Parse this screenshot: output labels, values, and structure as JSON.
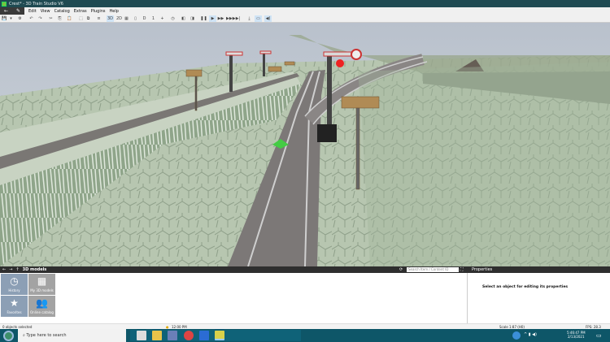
{
  "window": {
    "title": "Crest* - 3D Train Studio V6"
  },
  "menu": {
    "back": "←",
    "edit_mode": "✎",
    "items": [
      "Edit",
      "View",
      "Catalog",
      "Extras",
      "Plugins",
      "Help"
    ]
  },
  "toolbar": {
    "buttons": [
      {
        "name": "save",
        "glyph": "💾",
        "on": false
      },
      {
        "name": "save-dropdown",
        "glyph": "▾",
        "on": false
      },
      {
        "name": "settings",
        "glyph": "⚙",
        "on": false
      },
      {
        "name": "undo",
        "glyph": "↶",
        "on": false
      },
      {
        "name": "redo",
        "glyph": "↷",
        "on": false
      },
      {
        "name": "cut",
        "glyph": "✂",
        "on": false
      },
      {
        "name": "copy",
        "glyph": "⎘",
        "on": false
      },
      {
        "name": "paste",
        "glyph": "📋",
        "on": false
      },
      {
        "name": "group",
        "glyph": "⬚",
        "on": false
      },
      {
        "name": "ungroup",
        "glyph": "⧉",
        "on": false
      },
      {
        "name": "layers",
        "glyph": "≡",
        "on": false
      },
      {
        "name": "view-3d",
        "glyph": "3D",
        "on": true
      },
      {
        "name": "view-2d",
        "glyph": "2D",
        "on": false
      },
      {
        "name": "grid",
        "glyph": "▦",
        "on": false
      },
      {
        "name": "height",
        "glyph": "▯",
        "on": false
      },
      {
        "name": "D",
        "glyph": "D",
        "on": false
      },
      {
        "name": "1",
        "glyph": "1",
        "on": false
      },
      {
        "name": "add",
        "glyph": "+",
        "on": false
      },
      {
        "name": "clock",
        "glyph": "◷",
        "on": false
      },
      {
        "name": "panel-a",
        "glyph": "◧",
        "on": false
      },
      {
        "name": "panel-b",
        "glyph": "◨",
        "on": false
      },
      {
        "name": "pause",
        "glyph": "❚❚",
        "on": false
      },
      {
        "name": "play",
        "glyph": "▶",
        "on": true
      },
      {
        "name": "fast-forward",
        "glyph": "▶▶",
        "on": false
      },
      {
        "name": "faster",
        "glyph": "▶▶▶",
        "on": false
      },
      {
        "name": "skip-end",
        "glyph": "▶|",
        "on": false
      },
      {
        "name": "download",
        "glyph": "⤓",
        "on": false
      },
      {
        "name": "speed",
        "glyph": "▭",
        "on": true
      },
      {
        "name": "sound",
        "glyph": "◀)",
        "on": true
      }
    ]
  },
  "catalog": {
    "path": "3D models",
    "nav": [
      "←",
      "→",
      "↑"
    ],
    "search_placeholder": "Search Item / Content ID",
    "tiles": [
      {
        "label": "History",
        "icon": "◷"
      },
      {
        "label": "My 3D models",
        "icon": "▦"
      },
      {
        "label": "Favorites",
        "icon": "★"
      },
      {
        "label": "Online catalog",
        "icon": "👥"
      }
    ]
  },
  "properties": {
    "title": "Properties",
    "message": "Select an object for editing its properties"
  },
  "status": {
    "selected": "0 objects selected",
    "time": "12:00 PM",
    "scale": "Scale 1:87 (H0)",
    "fps": "FPS: 28.3"
  },
  "taskbar": {
    "search_placeholder": "Type here to search",
    "clock_time": "5:46:47 PM",
    "clock_date": "2/13/2021"
  },
  "colors": {
    "titlebar": "#1f4a52",
    "taskbar": "#0e5668",
    "toggle_on": "#cfe3f5"
  }
}
